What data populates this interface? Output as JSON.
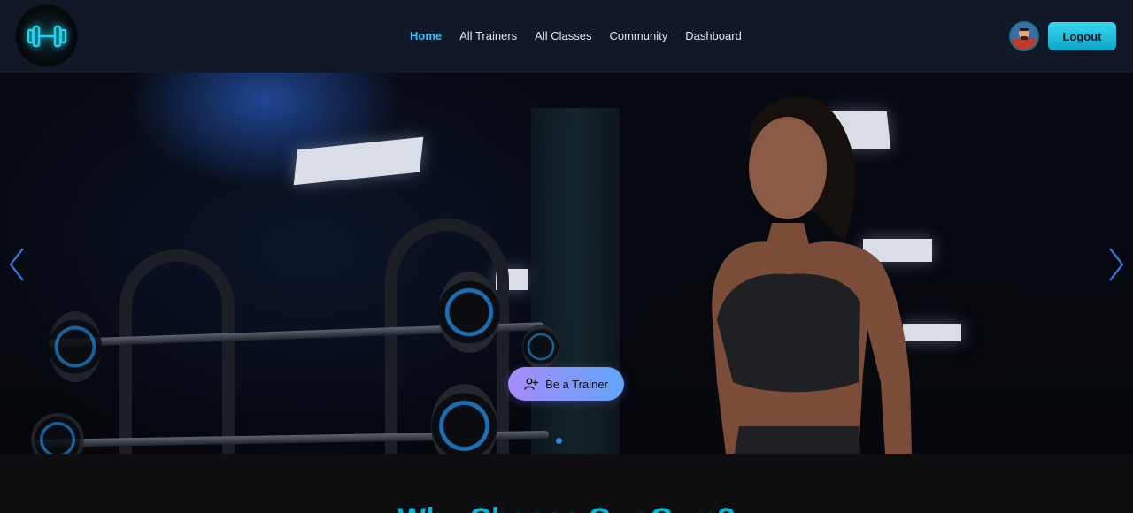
{
  "brand": {
    "logo_icon": "dumbbell-icon",
    "accent": "#22d3ee"
  },
  "nav": {
    "links": [
      {
        "label": "Home",
        "active": true
      },
      {
        "label": "All Trainers",
        "active": false
      },
      {
        "label": "All Classes",
        "active": false
      },
      {
        "label": "Community",
        "active": false
      },
      {
        "label": "Dashboard",
        "active": false
      }
    ],
    "active_color": "#38bdf8"
  },
  "user": {
    "avatar_icon": "user-avatar",
    "logout_label": "Logout"
  },
  "hero": {
    "cta_label": "Be a Trainer",
    "cta_icon": "user-plus-icon",
    "prev_icon": "chevron-left-icon",
    "next_icon": "chevron-right-icon",
    "slide_dots": 1,
    "active_slide": 1
  },
  "section": {
    "title": "Why Choose Our Gym?"
  }
}
